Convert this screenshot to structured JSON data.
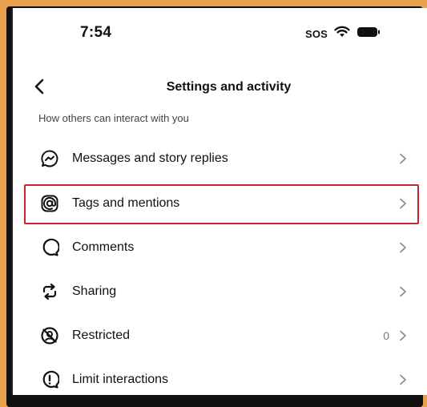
{
  "status_bar": {
    "time": "7:54",
    "carrier_text": "SOS"
  },
  "header": {
    "title": "Settings and activity"
  },
  "section": {
    "label": "How others can interact with you"
  },
  "rows": [
    {
      "label": "Messages and story replies",
      "icon": "messenger-icon",
      "count": ""
    },
    {
      "label": "Tags and mentions",
      "icon": "at-sign-icon",
      "count": "",
      "highlighted": true
    },
    {
      "label": "Comments",
      "icon": "comment-icon",
      "count": ""
    },
    {
      "label": "Sharing",
      "icon": "share-repost-icon",
      "count": ""
    },
    {
      "label": "Restricted",
      "icon": "restricted-icon",
      "count": "0"
    },
    {
      "label": "Limit interactions",
      "icon": "limit-interactions-icon",
      "count": ""
    }
  ],
  "colors": {
    "highlight": "#c4262d",
    "background_border": "#e9a04a"
  }
}
